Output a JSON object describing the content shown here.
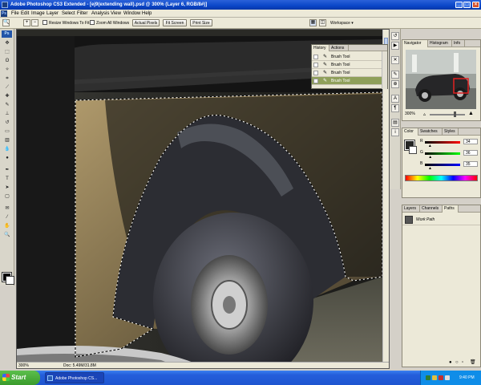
{
  "window": {
    "title": "Adobe Photoshop CS3 Extended - [ej9(extending wall).psd @ 300% (Layer 6, RGB/8#)]"
  },
  "menu": [
    "File",
    "Edit",
    "Image",
    "Layer",
    "Select",
    "Filter",
    "Analysis",
    "View",
    "Window",
    "Help"
  ],
  "options_bar": {
    "resize_windows_label": "Resize Windows To Fit",
    "zoom_all_windows_label": "Zoom All Windows",
    "actual_pixels_label": "Actual Pixels",
    "fit_screen_label": "Fit Screen",
    "print_size_label": "Print Size",
    "workspace_label": "Workspace ▾"
  },
  "history_panel": {
    "tabs": [
      "History",
      "Actions"
    ],
    "items": [
      "Brush Tool",
      "Brush Tool",
      "Brush Tool",
      "Brush Tool"
    ],
    "active_index": 3
  },
  "navigator_panel": {
    "tabs": [
      "Navigator",
      "Histogram",
      "Info"
    ],
    "zoom": "300%"
  },
  "color_panel": {
    "tabs": [
      "Color",
      "Swatches",
      "Styles"
    ],
    "rows": [
      {
        "label": "R",
        "value": "34"
      },
      {
        "label": "G",
        "value": "36"
      },
      {
        "label": "B",
        "value": "35"
      }
    ],
    "fill_fractions": [
      0.133,
      0.141,
      0.137
    ]
  },
  "paths_panel": {
    "tabs": [
      "Layers",
      "Channels",
      "Paths"
    ],
    "items": [
      "Work Path"
    ]
  },
  "document": {
    "zoom": "300%",
    "doc_info": "Doc: 5.49M/31.8M"
  },
  "taskbar": {
    "start_label": "Start",
    "task_label": "Adobe Photoshop CS...",
    "clock": "9:40 PM"
  },
  "colors": {
    "title_bar": "#0a46c8",
    "history_selected": "#8fa05a",
    "selection_fill": "#8c7a55",
    "taskbar": "#245edb",
    "start_button": "#3a9b2c"
  }
}
